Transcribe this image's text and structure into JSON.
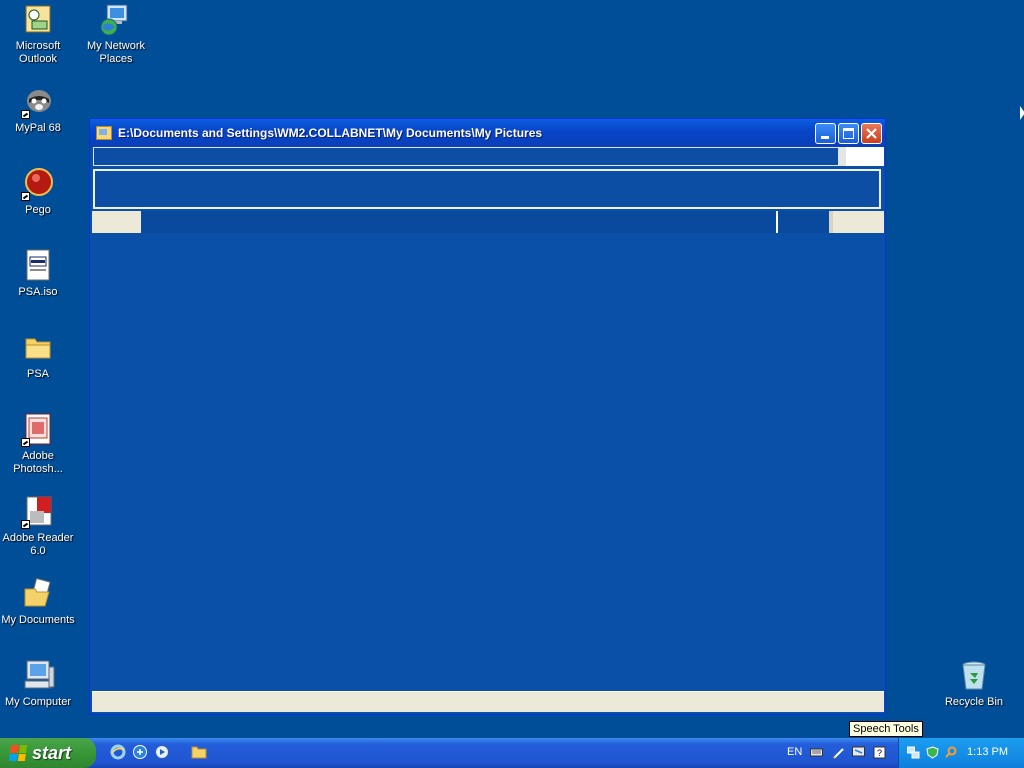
{
  "desktop": {
    "icons": [
      {
        "label": "Microsoft Outlook",
        "icon": "outlook-icon"
      },
      {
        "label": "My Network Places",
        "icon": "network-places-icon"
      },
      {
        "label": "MyPal 68",
        "icon": "mypal-icon"
      },
      {
        "label": "Pego",
        "icon": "pego-icon"
      },
      {
        "label": "PSA.iso",
        "icon": "iso-file-icon"
      },
      {
        "label": "PSA",
        "icon": "folder-icon"
      },
      {
        "label": "Adobe Photosh...",
        "icon": "photoshop-icon"
      },
      {
        "label": "Adobe Reader 6.0",
        "icon": "adobe-reader-icon"
      },
      {
        "label": "My Documents",
        "icon": "my-documents-icon"
      },
      {
        "label": "My Computer",
        "icon": "my-computer-icon"
      },
      {
        "label": "Recycle Bin",
        "icon": "recycle-bin-icon"
      }
    ]
  },
  "window": {
    "title": "E:\\Documents and Settings\\WM2.COLLABNET\\My Documents\\My Pictures"
  },
  "taskbar": {
    "start_label": "start",
    "language": "EN",
    "time": "1:13 PM"
  },
  "tooltip": {
    "text": "Speech Tools"
  },
  "colors": {
    "desktop": "#004e98",
    "taskbar": "#245edb",
    "start": "#3a9a3a",
    "tray": "#0f7fdc"
  }
}
